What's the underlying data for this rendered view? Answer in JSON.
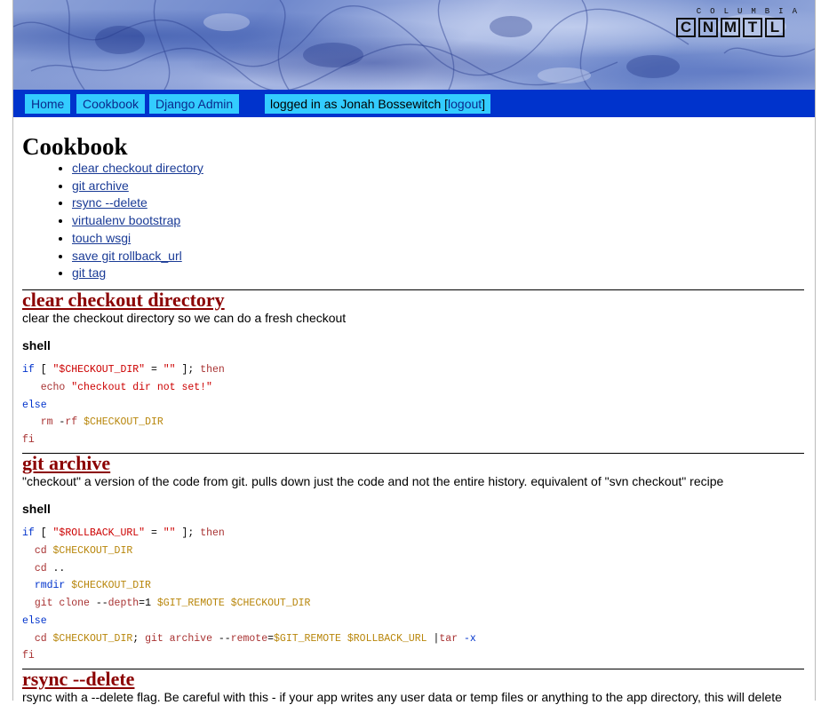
{
  "logo": {
    "top_text": "COLUMBIA",
    "letters": [
      "C",
      "N",
      "M",
      "T",
      "L"
    ]
  },
  "nav": {
    "home": "Home",
    "cookbook": "Cookbook",
    "django_admin": "Django Admin",
    "logged_in_prefix": "logged in as Jonah Bossewitch [",
    "logout": "logout",
    "logged_in_suffix": "]"
  },
  "page_title": "Cookbook",
  "toc": [
    "clear checkout directory",
    "git archive",
    "rsync --delete",
    "virtualenv bootstrap",
    "touch wsgi",
    "save git rollback_url",
    "git tag"
  ],
  "sections": [
    {
      "title": "clear checkout directory",
      "description": "clear the checkout directory so we can do a fresh checkout",
      "language": "shell"
    },
    {
      "title": "git archive",
      "description": "\"checkout\" a version of the code from git. pulls down just the code and not the entire history. equivalent of \"svn checkout\" recipe",
      "language": "shell"
    },
    {
      "title": "rsync --delete",
      "description": "rsync with a --delete flag. Be careful with this - if your app writes any user data or temp files or anything to the app directory, this will delete"
    }
  ],
  "code": {
    "s1": {
      "l1_if": "if",
      "l1_a": " [ ",
      "l1_str": "\"$CHECKOUT_DIR\"",
      "l1_b": " = ",
      "l1_empty": "\"\"",
      "l1_c": " ]; ",
      "l1_then": "then",
      "l2_indent": "   ",
      "l2_echo": "echo",
      "l2_sp": " ",
      "l2_str": "\"checkout dir not set!\"",
      "l3_else": "else",
      "l4_indent": "   ",
      "l4_rm": "rm",
      "l4_sp": " -",
      "l4_rf": "rf",
      "l4_sp2": " ",
      "l4_var": "$CHECKOUT_DIR",
      "l5_fi": "fi"
    },
    "s2": {
      "l1_if": "if",
      "l1_a": " [ ",
      "l1_str": "\"$ROLLBACK_URL\"",
      "l1_b": " = ",
      "l1_empty": "\"\"",
      "l1_c": " ]; ",
      "l1_then": "then",
      "l2_indent": "  ",
      "l2_cd": "cd",
      "l2_sp": " ",
      "l2_var": "$CHECKOUT_DIR",
      "l3_indent": "  ",
      "l3_cd": "cd",
      "l3_rest": " ..",
      "l4_indent": "  ",
      "l4_rmdir": "rmdir",
      "l4_sp": " ",
      "l4_var": "$CHECKOUT_DIR",
      "l5_indent": "  ",
      "l5_git": "git clone",
      "l5_sp": " --",
      "l5_depth": "depth",
      "l5_eq": "=1 ",
      "l5_var1": "$GIT_REMOTE",
      "l5_sp2": " ",
      "l5_var2": "$CHECKOUT_DIR",
      "l6_else": "else",
      "l7_indent": "  ",
      "l7_cd": "cd",
      "l7_sp": " ",
      "l7_var": "$CHECKOUT_DIR",
      "l7_semi": "; ",
      "l7_git": "git archive",
      "l7_sp2": " --",
      "l7_remote": "remote",
      "l7_eq": "=",
      "l7_var2": "$GIT_REMOTE",
      "l7_sp3": " ",
      "l7_var3": "$ROLLBACK_URL",
      "l7_pipe": " |",
      "l7_tar": "tar",
      "l7_sp4": " ",
      "l7_x": "-x",
      "l8_fi": "fi"
    }
  }
}
